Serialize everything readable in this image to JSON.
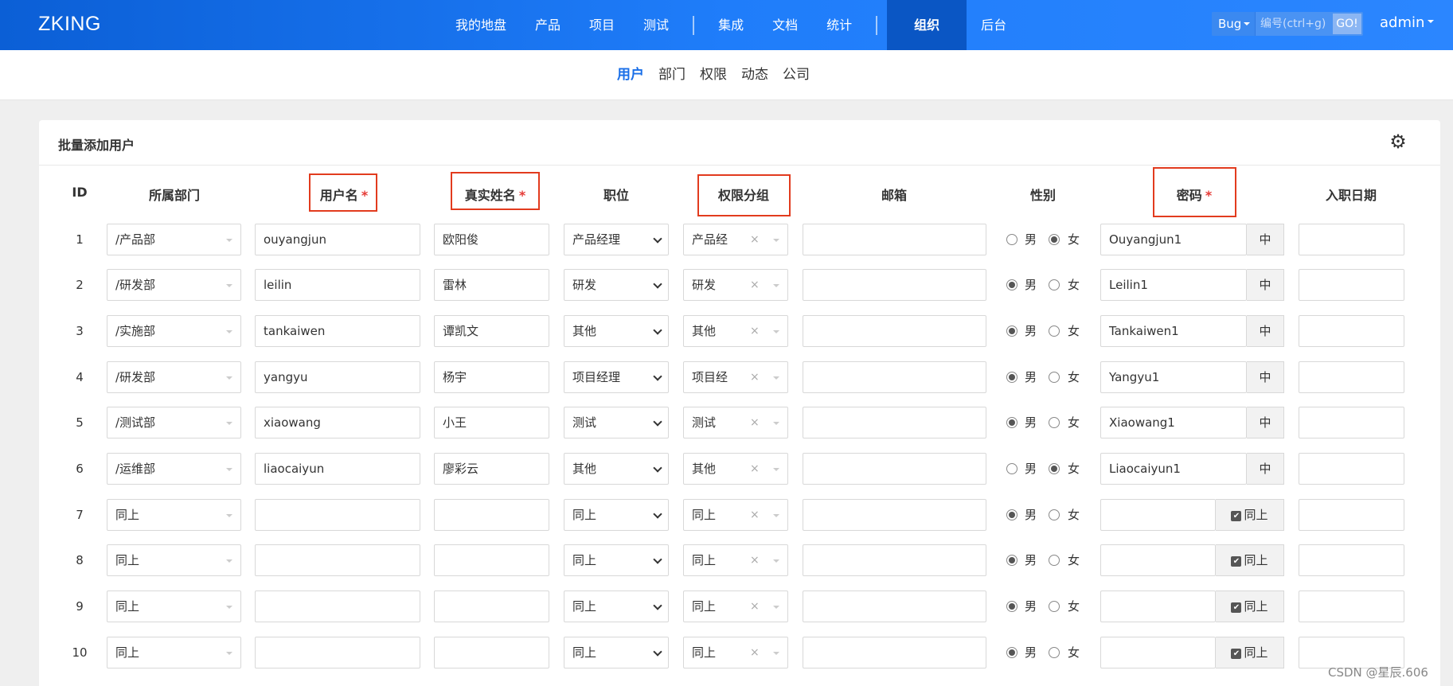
{
  "app": {
    "logo": "ZKING"
  },
  "nav": {
    "items": [
      "我的地盘",
      "产品",
      "项目",
      "测试"
    ],
    "items2": [
      "集成",
      "文档",
      "统计"
    ],
    "active": "组织",
    "last": "后台"
  },
  "search": {
    "type": "Bug",
    "placeholder": "编号(ctrl+g)",
    "go": "GO!"
  },
  "user": "admin",
  "subnav": [
    "用户",
    "部门",
    "权限",
    "动态",
    "公司"
  ],
  "panel": {
    "title": "批量添加用户"
  },
  "columns": {
    "id": "ID",
    "dept": "所属部门",
    "account": "用户名",
    "realname": "真实姓名",
    "role": "职位",
    "group": "权限分组",
    "email": "邮箱",
    "gender": "性别",
    "password": "密码",
    "join": "入职日期"
  },
  "required_mark": "*",
  "gender_labels": {
    "male": "男",
    "female": "女"
  },
  "clear_icon": "×",
  "password_addon": "中",
  "same_as_above_check": "同上",
  "rows": [
    {
      "id": "1",
      "dept": "/产品部",
      "account": "ouyangjun",
      "realname": "欧阳俊",
      "role": "产品经理",
      "group": "产品经",
      "gender": "female",
      "password": "Ouyangjun1"
    },
    {
      "id": "2",
      "dept": "/研发部",
      "account": "leilin",
      "realname": "雷林",
      "role": "研发",
      "group": "研发",
      "gender": "male",
      "password": "Leilin1"
    },
    {
      "id": "3",
      "dept": "/实施部",
      "account": "tankaiwen",
      "realname": "谭凯文",
      "role": "其他",
      "group": "其他",
      "gender": "male",
      "password": "Tankaiwen1"
    },
    {
      "id": "4",
      "dept": "/研发部",
      "account": "yangyu",
      "realname": "杨宇",
      "role": "项目经理",
      "group": "项目经",
      "gender": "male",
      "password": "Yangyu1"
    },
    {
      "id": "5",
      "dept": "/测试部",
      "account": "xiaowang",
      "realname": "小王",
      "role": "测试",
      "group": "测试",
      "gender": "male",
      "password": "Xiaowang1"
    },
    {
      "id": "6",
      "dept": "/运维部",
      "account": "liaocaiyun",
      "realname": "廖彩云",
      "role": "其他",
      "group": "其他",
      "gender": "female",
      "password": "Liaocaiyun1"
    },
    {
      "id": "7",
      "dept": "同上",
      "account": "",
      "realname": "",
      "role": "同上",
      "group": "同上",
      "gender": "male",
      "password": ""
    },
    {
      "id": "8",
      "dept": "同上",
      "account": "",
      "realname": "",
      "role": "同上",
      "group": "同上",
      "gender": "male",
      "password": ""
    },
    {
      "id": "9",
      "dept": "同上",
      "account": "",
      "realname": "",
      "role": "同上",
      "group": "同上",
      "gender": "male",
      "password": ""
    },
    {
      "id": "10",
      "dept": "同上",
      "account": "",
      "realname": "",
      "role": "同上",
      "group": "同上",
      "gender": "male",
      "password": ""
    }
  ],
  "watermark": "CSDN @星辰.606"
}
